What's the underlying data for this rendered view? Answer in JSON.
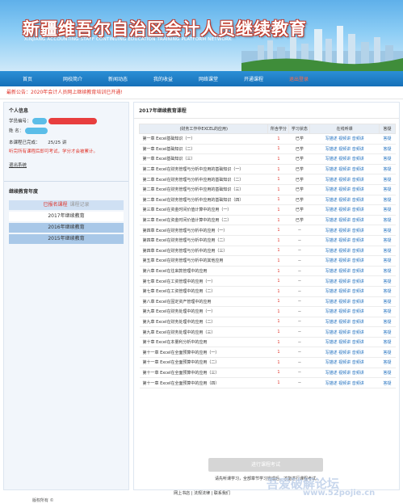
{
  "header": {
    "title": "新疆维吾尔自治区会计人员继续教育",
    "subtitle": "XINJIANG ACCOUNTING STAFF CONTINUING EDUCATION TRAINING PLATFORM NETWORK"
  },
  "nav": [
    "首页",
    "网校简介",
    "新闻动态",
    "我的收益",
    "网络课堂",
    "开通课程",
    "退出登录"
  ],
  "notice": "最新公告：2020年会计人员网上继续教育培训已开通!",
  "left": {
    "personal_title": "个人信息",
    "id_label": "学员编号：",
    "name_label": "姓     名：",
    "year_progress_label": "本课程已完成：",
    "year_progress_value": "25/25 讲",
    "warning": "听完所有课程后即可考试，学分才会被累计。",
    "logout": "退出系统",
    "edu_title": "继续教育年度",
    "years": [
      {
        "label": "已报名课程",
        "extra": "课程记录"
      },
      {
        "label": "2017年继续教育"
      },
      {
        "label": "2016年继续教育"
      },
      {
        "label": "2015年继续教育"
      }
    ]
  },
  "main": {
    "title": "2017年继续教育课程",
    "columns": [
      "(财务工作中EXCEL的应用)",
      "所含学分",
      "学习状态",
      "在线听课",
      "答疑"
    ],
    "rows": [
      {
        "name": "第一章  Excel基础知识（一）",
        "credit": "1",
        "status": "已学",
        "links": "写描述 视频讲 音频讲",
        "qa": "答疑"
      },
      {
        "name": "第一章  Excel基础知识（二）",
        "credit": "1",
        "status": "已学",
        "links": "写描述 视频讲 音频讲",
        "qa": "答疑"
      },
      {
        "name": "第一章  Excel基础知识（三）",
        "credit": "1",
        "status": "已学",
        "links": "写描述 视频讲 音频讲",
        "qa": "答疑"
      },
      {
        "name": "第二章  Excel在财务管理与分析中应用的基础知识（一）",
        "credit": "1",
        "status": "已学",
        "links": "写描述 视频讲 音频讲",
        "qa": "答疑"
      },
      {
        "name": "第二章  Excel在财务管理与分析中应用的基础知识（二）",
        "credit": "1",
        "status": "已学",
        "links": "写描述 视频讲 音频讲",
        "qa": "答疑"
      },
      {
        "name": "第二章  Excel在财务管理与分析中应用的基础知识（三）",
        "credit": "1",
        "status": "已学",
        "links": "写描述 视频讲 音频讲",
        "qa": "答疑"
      },
      {
        "name": "第二章  Excel在财务管理与分析中应用的基础知识（四）",
        "credit": "1",
        "status": "已学",
        "links": "写描述 视频讲 音频讲",
        "qa": "答疑"
      },
      {
        "name": "第三章  Excel在资金时间价值计算中的应用（一）",
        "credit": "1",
        "status": "已学",
        "links": "写描述 视频讲 音频讲",
        "qa": "答疑"
      },
      {
        "name": "第三章  Excel在资金时间价值计算中的应用（二）",
        "credit": "1",
        "status": "已学",
        "links": "写描述 视频讲 音频讲",
        "qa": "答疑"
      },
      {
        "name": "第四章  Excel在财务管理与分析中的应用（一）",
        "credit": "1",
        "status": "--",
        "links": "写描述 视频讲 音频讲",
        "qa": "答疑"
      },
      {
        "name": "第四章  Excel在财务管理与分析中的应用（二）",
        "credit": "1",
        "status": "--",
        "links": "写描述 视频讲 音频讲",
        "qa": "答疑"
      },
      {
        "name": "第四章  Excel在财务管理与分析中的应用（三）",
        "credit": "1",
        "status": "--",
        "links": "写描述 视频讲 音频讲",
        "qa": "答疑"
      },
      {
        "name": "第五章  Excel在财务管理与分析中的其他应用",
        "credit": "1",
        "status": "--",
        "links": "写描述 视频讲 音频讲",
        "qa": "答疑"
      },
      {
        "name": "第六章  Excel在往来款管理中的应用",
        "credit": "1",
        "status": "--",
        "links": "写描述 视频讲 音频讲",
        "qa": "答疑"
      },
      {
        "name": "第七章  Excel在工资管理中的应用（一）",
        "credit": "1",
        "status": "--",
        "links": "写描述 视频讲 音频讲",
        "qa": "答疑"
      },
      {
        "name": "第七章  Excel在工资管理中的应用（二）",
        "credit": "1",
        "status": "--",
        "links": "写描述 视频讲 音频讲",
        "qa": "答疑"
      },
      {
        "name": "第八章  Excel在固定资产管理中的应用",
        "credit": "1",
        "status": "--",
        "links": "写描述 视频讲 音频讲",
        "qa": "答疑"
      },
      {
        "name": "第九章  Excel在财务处理中的应用（一）",
        "credit": "1",
        "status": "--",
        "links": "写描述 视频讲 音频讲",
        "qa": "答疑"
      },
      {
        "name": "第九章  Excel在财务处理中的应用（二）",
        "credit": "1",
        "status": "--",
        "links": "写描述 视频讲 音频讲",
        "qa": "答疑"
      },
      {
        "name": "第九章  Excel在财务处理中的应用（三）",
        "credit": "1",
        "status": "--",
        "links": "写描述 视频讲 音频讲",
        "qa": "答疑"
      },
      {
        "name": "第十章  Excel在本量利分析中的应用",
        "credit": "1",
        "status": "--",
        "links": "写描述 视频讲 音频讲",
        "qa": "答疑"
      },
      {
        "name": "第十一章  Excel在全面预算中的应用（一）",
        "credit": "1",
        "status": "--",
        "links": "写描述 视频讲 音频讲",
        "qa": "答疑"
      },
      {
        "name": "第十一章  Excel在全面预算中的应用（二）",
        "credit": "1",
        "status": "--",
        "links": "写描述 视频讲 音频讲",
        "qa": "答疑"
      },
      {
        "name": "第十一章  Excel在全面预算中的应用（三）",
        "credit": "1",
        "status": "--",
        "links": "写描述 视频讲 音频讲",
        "qa": "答疑"
      },
      {
        "name": "第十一章  Excel在全面预算中的应用（四）",
        "credit": "1",
        "status": "--",
        "links": "写描述 视频讲 音频讲",
        "qa": "答疑"
      }
    ],
    "exam_button": "进行课程考试",
    "tip": "请先听课学习，全部章节学习完成后，才能进行课程考试。"
  },
  "footer": {
    "links": "网上书店 | 法规法律 | 联系我们",
    "bottom": "版权所有 ©"
  },
  "watermark": {
    "line1": "吾爱破解论坛",
    "line2": "www.52pojie.cn"
  }
}
